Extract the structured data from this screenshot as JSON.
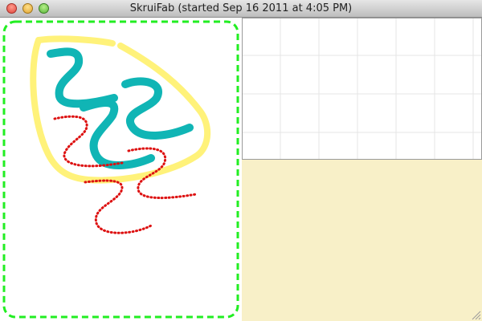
{
  "window": {
    "title": "SkruiFab (started Sep 16 2011 at 4:05 PM)"
  },
  "colors": {
    "board_border": "#22ee22",
    "highlight_stroke": "#fff27a",
    "teal_stroke": "#10b5b5",
    "red_stroke": "#dd1111",
    "grid_line": "#e6e6e6",
    "background": "#f8f0c8"
  },
  "icons": {
    "close": "close-button",
    "minimize": "minimize-button",
    "zoom": "zoom-button",
    "resize": "resize-grip-icon"
  }
}
